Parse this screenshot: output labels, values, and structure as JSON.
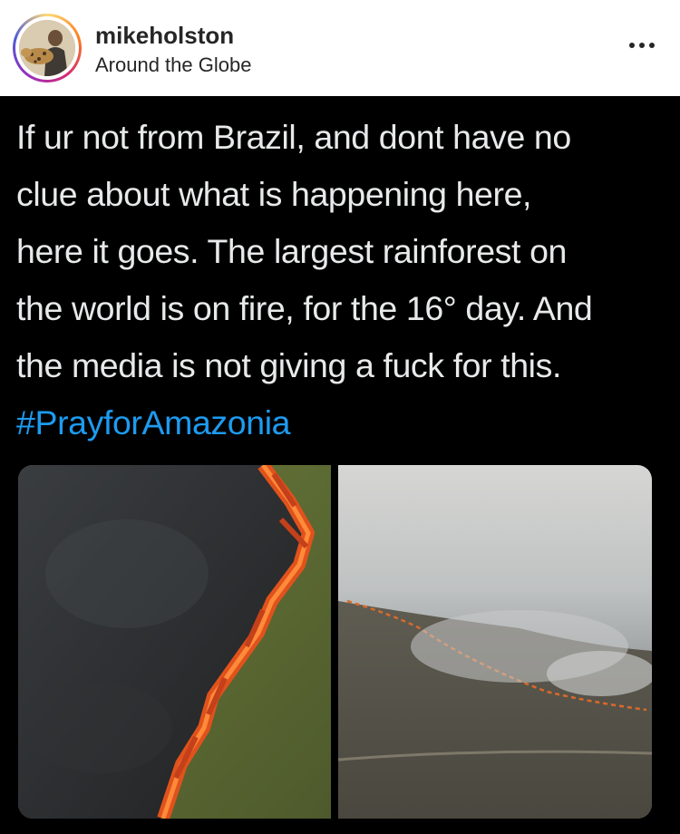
{
  "post": {
    "username": "mikeholston",
    "location": "Around the Globe",
    "more_icon": "more-horizontal-icon"
  },
  "tweet": {
    "lines": [
      "If ur not from Brazil, and dont have no",
      "clue about what is happening here,",
      "here it goes. The largest rainforest on",
      "the world is on fire, for the 16° day. And",
      "the media is not giving a fuck for this."
    ],
    "hashtag": "#PrayforAmazonia"
  },
  "colors": {
    "background": "#000000",
    "text": "#e7e9ea",
    "hashtag": "#1d9bf0",
    "header_bg": "#ffffff"
  }
}
